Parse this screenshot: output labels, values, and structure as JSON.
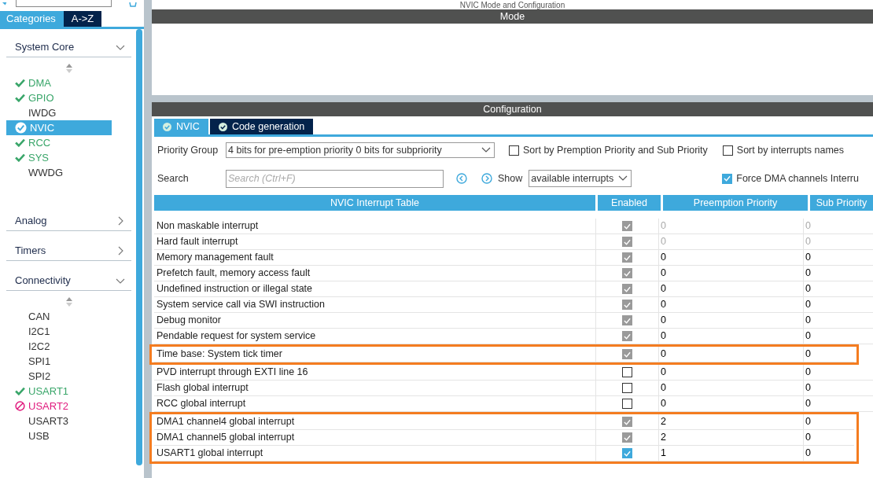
{
  "sidebar": {
    "tabs": [
      {
        "label": "Categories",
        "selected": true
      },
      {
        "label": "A->Z",
        "selected": false
      }
    ],
    "categories": [
      {
        "name": "System Core",
        "expanded": true,
        "items": [
          {
            "label": "DMA",
            "kind": "ok",
            "selected": false
          },
          {
            "label": "GPIO",
            "kind": "ok",
            "selected": false
          },
          {
            "label": "IWDG",
            "kind": "none",
            "selected": false
          },
          {
            "label": "NVIC",
            "kind": "ok",
            "selected": true
          },
          {
            "label": "RCC",
            "kind": "ok",
            "selected": false
          },
          {
            "label": "SYS",
            "kind": "ok",
            "selected": false
          },
          {
            "label": "WWDG",
            "kind": "none",
            "selected": false
          }
        ]
      },
      {
        "name": "Analog",
        "expanded": false
      },
      {
        "name": "Timers",
        "expanded": false
      },
      {
        "name": "Connectivity",
        "expanded": true,
        "items": [
          {
            "label": "CAN",
            "kind": "none",
            "selected": false
          },
          {
            "label": "I2C1",
            "kind": "none",
            "selected": false
          },
          {
            "label": "I2C2",
            "kind": "none",
            "selected": false
          },
          {
            "label": "SPI1",
            "kind": "none",
            "selected": false
          },
          {
            "label": "SPI2",
            "kind": "none",
            "selected": false
          },
          {
            "label": "USART1",
            "kind": "ok",
            "selected": false
          },
          {
            "label": "USART2",
            "kind": "error",
            "selected": false
          },
          {
            "label": "USART3",
            "kind": "none",
            "selected": false
          },
          {
            "label": "USB",
            "kind": "none",
            "selected": false
          }
        ]
      }
    ]
  },
  "page_title": "NVIC Mode and Configuration",
  "mode_header": "Mode",
  "config_header": "Configuration",
  "config_tabs": [
    {
      "label": "NVIC",
      "selected": true
    },
    {
      "label": "Code generation",
      "selected": false
    }
  ],
  "priority_group": {
    "label": "Priority Group",
    "value": "4 bits for pre-emption priority 0 bits for subpriority"
  },
  "sort_options": [
    {
      "label": "Sort by Premption Priority and Sub Priority",
      "checked": false
    },
    {
      "label": "Sort by interrupts names",
      "checked": false
    }
  ],
  "search": {
    "label": "Search",
    "placeholder": "Search (Ctrl+F)"
  },
  "show": {
    "label": "Show",
    "value": "available interrupts"
  },
  "force_dma": {
    "label": "Force DMA channels Interru",
    "checked": true
  },
  "table": {
    "columns": [
      "NVIC Interrupt Table",
      "Enabled",
      "Preemption Priority",
      "Sub Priority"
    ],
    "rows": [
      {
        "name": "Non maskable interrupt",
        "enabled": true,
        "locked": true,
        "priority_locked": true,
        "preemption": "0",
        "sub": "0",
        "highlighted": false
      },
      {
        "name": "Hard fault interrupt",
        "enabled": true,
        "locked": true,
        "priority_locked": true,
        "preemption": "0",
        "sub": "0",
        "highlighted": false
      },
      {
        "name": "Memory management fault",
        "enabled": true,
        "locked": true,
        "priority_locked": false,
        "preemption": "0",
        "sub": "0",
        "highlighted": false
      },
      {
        "name": "Prefetch fault, memory access fault",
        "enabled": true,
        "locked": true,
        "priority_locked": false,
        "preemption": "0",
        "sub": "0",
        "highlighted": false
      },
      {
        "name": "Undefined instruction or illegal state",
        "enabled": true,
        "locked": true,
        "priority_locked": false,
        "preemption": "0",
        "sub": "0",
        "highlighted": false
      },
      {
        "name": "System service call via SWI instruction",
        "enabled": true,
        "locked": true,
        "priority_locked": false,
        "preemption": "0",
        "sub": "0",
        "highlighted": false
      },
      {
        "name": "Debug monitor",
        "enabled": true,
        "locked": true,
        "priority_locked": false,
        "preemption": "0",
        "sub": "0",
        "highlighted": false
      },
      {
        "name": "Pendable request for system service",
        "enabled": true,
        "locked": true,
        "priority_locked": false,
        "preemption": "0",
        "sub": "0",
        "highlighted": false
      },
      {
        "name": "Time base: System tick timer",
        "enabled": true,
        "locked": true,
        "priority_locked": false,
        "preemption": "0",
        "sub": "0",
        "highlighted": true
      },
      {
        "name": "PVD interrupt through EXTI line 16",
        "enabled": false,
        "locked": false,
        "priority_locked": false,
        "preemption": "0",
        "sub": "0",
        "highlighted": false
      },
      {
        "name": "Flash global interrupt",
        "enabled": false,
        "locked": false,
        "priority_locked": false,
        "preemption": "0",
        "sub": "0",
        "highlighted": false
      },
      {
        "name": "RCC global interrupt",
        "enabled": false,
        "locked": false,
        "priority_locked": false,
        "preemption": "0",
        "sub": "0",
        "highlighted": false
      },
      {
        "name": "DMA1 channel4 global interrupt",
        "enabled": true,
        "locked": true,
        "priority_locked": false,
        "preemption": "2",
        "sub": "0",
        "highlighted": true
      },
      {
        "name": "DMA1 channel5 global interrupt",
        "enabled": true,
        "locked": true,
        "priority_locked": false,
        "preemption": "2",
        "sub": "0",
        "highlighted": true
      },
      {
        "name": "USART1 global interrupt",
        "enabled": true,
        "locked": false,
        "priority_locked": false,
        "preemption": "1",
        "sub": "0",
        "highlighted": true
      }
    ]
  }
}
